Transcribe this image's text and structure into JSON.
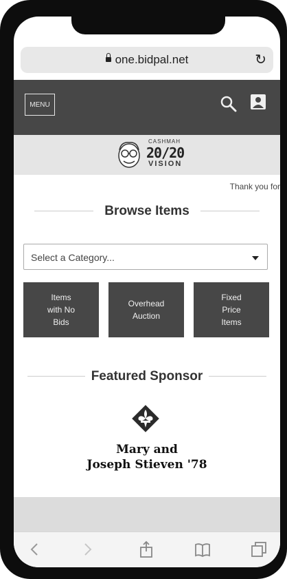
{
  "browser": {
    "url": "one.bidpal.net",
    "icons": [
      "lock-icon",
      "reload-icon"
    ]
  },
  "navbar": {
    "menu_label": "MENU",
    "icons": [
      "search-icon",
      "user-icon"
    ]
  },
  "logo": {
    "cash": "CASHMAH",
    "big": "20/20",
    "vision": "VISION"
  },
  "ticker": {
    "text": "Thank you for"
  },
  "browse": {
    "title": "Browse Items",
    "select_value": "Select a Category...",
    "tiles": [
      {
        "label": "Items\nwith No\nBids"
      },
      {
        "label": "Overhead\nAuction"
      },
      {
        "label": "Fixed\nPrice\nItems"
      }
    ]
  },
  "sponsor": {
    "title": "Featured Sponsor",
    "name": "Mary and\nJoseph Stieven '78"
  },
  "toolbar": {
    "icons": [
      "back-icon",
      "forward-icon",
      "share-icon",
      "bookmarks-icon",
      "tabs-icon"
    ]
  },
  "colors": {
    "navbar": "#474747",
    "tile": "#474747",
    "logo_strip": "#e5e5e5",
    "phone_frame": "#0d0d0d"
  }
}
